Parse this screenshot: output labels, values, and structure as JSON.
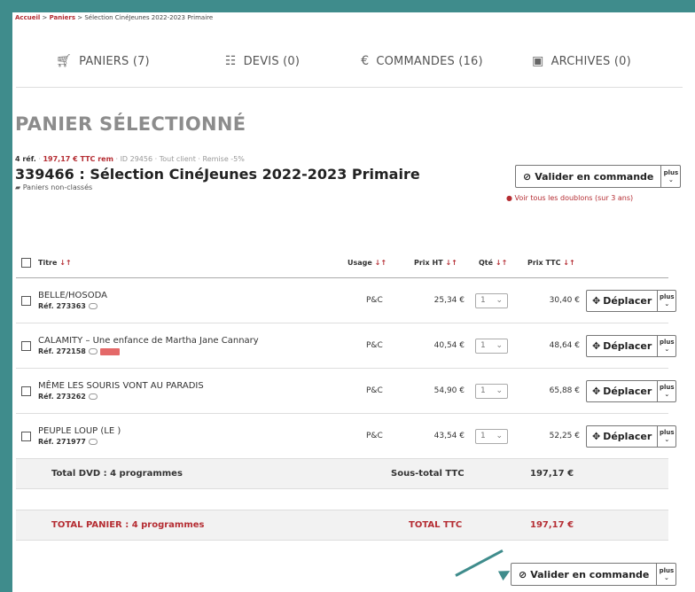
{
  "breadcrumb": {
    "home": "Accueil",
    "sep1": " > ",
    "carts": "Paniers",
    "sep2": " > ",
    "current": "Sélection CinéJeunes 2022-2023 Primaire"
  },
  "tabs": [
    {
      "label": "PANIERS (7)",
      "icon": "cart-icon"
    },
    {
      "label": "DEVIS (0)",
      "icon": "document-icon"
    },
    {
      "label": "COMMANDES (16)",
      "icon": "euro-icon"
    },
    {
      "label": "ARCHIVES (0)",
      "icon": "archive-icon"
    }
  ],
  "page_title": "PANIER SÉLECTIONNÉ",
  "meta": {
    "refs": "4 réf.",
    "sep": " · ",
    "total": "197,17 € TTC rem",
    "id": "ID 29456",
    "client": "Tout client",
    "discount": "Remise -5%"
  },
  "cart_name": "339466 : Sélection CinéJeunes 2022-2023 Primaire",
  "folder": "Paniers non-classés",
  "validate_label": "Valider en commande",
  "plus_label": "plus",
  "duplicate_warning": "Voir tous les doublons (sur 3 ans)",
  "table": {
    "headers": {
      "title": "Titre",
      "usage": "Usage",
      "price_ht": "Prix HT",
      "qty": "Qté",
      "price_ttc": "Prix TTC",
      "sort": "↓↑"
    },
    "rows": [
      {
        "title": "BELLE/HOSODA",
        "ref": "Réf. 273363",
        "usage": "P&C",
        "price_ht": "25,34 €",
        "qty": "1",
        "price_ttc": "30,40 €",
        "truck": false
      },
      {
        "title": "CALAMITY – Une enfance de Martha Jane Cannary",
        "ref": "Réf. 272158",
        "usage": "P&C",
        "price_ht": "40,54 €",
        "qty": "1",
        "price_ttc": "48,64 €",
        "truck": true
      },
      {
        "title": "MÊME LES SOURIS VONT AU PARADIS",
        "ref": "Réf. 273262",
        "usage": "P&C",
        "price_ht": "54,90 €",
        "qty": "1",
        "price_ttc": "65,88 €",
        "truck": false
      },
      {
        "title": "PEUPLE LOUP (LE )",
        "ref": "Réf. 271977",
        "usage": "P&C",
        "price_ht": "43,54 €",
        "qty": "1",
        "price_ttc": "52,25 €",
        "truck": false
      }
    ],
    "move_label": "Déplacer",
    "subtotal": {
      "label": "Total DVD : 4 programmes",
      "sub_label": "Sous-total TTC",
      "value": "197,17 €"
    },
    "total": {
      "label": "TOTAL PANIER : 4 programmes",
      "sub_label": "TOTAL TTC",
      "value": "197,17 €"
    }
  },
  "colors": {
    "accent": "#b52d33",
    "frame": "#3f8c8c"
  }
}
